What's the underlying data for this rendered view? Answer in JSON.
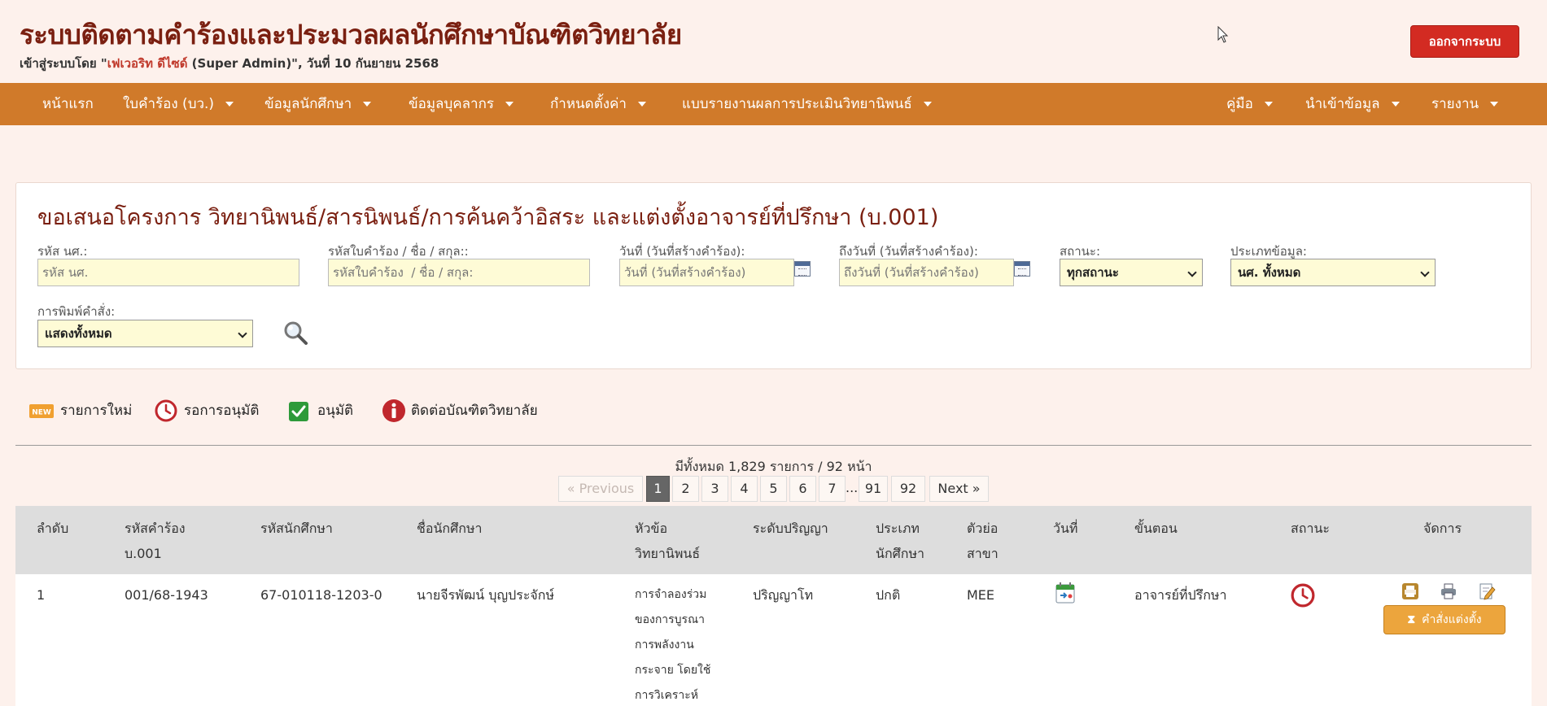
{
  "header": {
    "title": "ระบบติดตามคำร้องและประมวลผลนักศึกษาบัณฑิตวิทยาลัย",
    "login_prefix": "เข้าสู่ระบบโดย \"",
    "login_user": "เฟเวอริท ดีไซด์",
    "login_suffix": " (Super Admin)\",  วันที่ 10 กันยายน 2568",
    "logout_label": "ออกจากระบบ"
  },
  "nav": {
    "home": "หน้าแรก",
    "request": "ใบคำร้อง (บว.)",
    "student": "ข้อมูลนักศึกษา",
    "staff": "ข้อมูลบุคลากร",
    "settings": "กำหนดตั้งค่า",
    "report_form": "แบบรายงานผลการประเมินวิทยานิพนธ์",
    "manual": "คู่มือ",
    "import": "นำเข้าข้อมูล",
    "report": "รายงาน"
  },
  "panel": {
    "title": "ขอเสนอโครงการ วิทยานิพนธ์/สารนิพนธ์/การค้นคว้าอิสระ และแต่งตั้งอาจารย์ที่ปรึกษา (บ.001)",
    "student_id_label": "รหัส นศ.:",
    "student_id_placeholder": "รหัส นศ.",
    "request_label": "รหัสใบคำร้อง / ชื่อ / สกุล::",
    "request_placeholder": "รหัสใบคำร้อง  / ชื่อ / สกุล:",
    "date_from_label": "วันที่ (วันที่สร้างคำร้อง):",
    "date_from_placeholder": "วันที่ (วันที่สร้างคำร้อง)",
    "date_to_label": "ถึงวันที่ (วันที่สร้างคำร้อง):",
    "date_to_placeholder": "ถึงวันที่ (วันที่สร้างคำร้อง)",
    "status_label": "สถานะ:",
    "status_value": "ทุกสถานะ",
    "type_label": "ประเภทข้อมูล:",
    "type_value": "นศ. ทั้งหมด",
    "print_label": "การพิมพ์คำสั่ง:",
    "print_value": "แสดงทั้งหมด"
  },
  "legend": {
    "new_badge": "NEW",
    "new": "รายการใหม่",
    "waiting": "รอการอนุมัติ",
    "approved": "อนุมัติ",
    "contact": "ติดต่อบัณฑิตวิทยาลัย"
  },
  "pagination": {
    "summary": "มีทั้งหมด 1,829 รายการ / 92 หน้า",
    "prev": "« Previous",
    "pages": [
      "1",
      "2",
      "3",
      "4",
      "5",
      "6",
      "7"
    ],
    "ellipsis": "...",
    "p91": "91",
    "p92": "92",
    "next": "Next »"
  },
  "table": {
    "headers": {
      "no": "ลำดับ",
      "req_code": "รหัสคำร้อง บ.001",
      "student_id": "รหัสนักศึกษา",
      "name": "ชื่อนักศึกษา",
      "thesis": "หัวข้อ วิทยานิพนธ์",
      "degree": "ระดับปริญญา",
      "type": "ประเภท นักศึกษา",
      "major": "ตัวย่อ สาขา",
      "date": "วันที่",
      "step": "ขั้นตอน",
      "status": "สถานะ",
      "manage": "จัดการ"
    },
    "row": {
      "no": "1",
      "req_code": "001/68-1943",
      "student_id": "67-010118-1203-0",
      "name": "นายจีรพัฒน์ บุญประจักษ์",
      "thesis": "การจำลองร่วมของการบูรณาการพลังงานกระจาย โดยใช้การวิเคราะห์",
      "degree": "ปริญญาโท",
      "type": "ปกติ",
      "major": "MEE",
      "step": "อาจารย์ที่ปรึกษา",
      "appoint_label": "คำสั่งแต่งตั้ง"
    }
  }
}
